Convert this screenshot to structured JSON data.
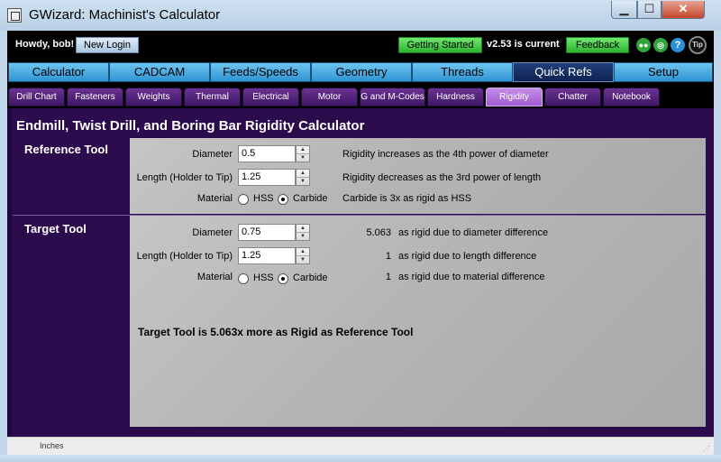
{
  "window": {
    "title": "GWizard: Machinist's Calculator",
    "icon": "app-icon"
  },
  "header": {
    "greeting": "Howdy, bob!",
    "new_login": "New Login",
    "getting_started": "Getting Started",
    "version": "v2.53 is current",
    "feedback": "Feedback",
    "tip": "Tip"
  },
  "main_tabs": [
    "Calculator",
    "CADCAM",
    "Feeds/Speeds",
    "Geometry",
    "Threads",
    "Quick Refs",
    "Setup"
  ],
  "active_main_tab": "Quick Refs",
  "sub_tabs": [
    "Drill Chart",
    "Fasteners",
    "Weights",
    "Thermal",
    "Electrical",
    "Motor",
    "G and M-Codes",
    "Hardness",
    "Rigidity",
    "Chatter",
    "Notebook"
  ],
  "active_sub_tab": "Rigidity",
  "calculator": {
    "title": "Endmill, Twist Drill, and Boring Bar Rigidity Calculator",
    "reference": {
      "heading": "Reference Tool",
      "diameter_label": "Diameter",
      "diameter": "0.5",
      "length_label": "Length (Holder to Tip)",
      "length": "1.25",
      "material_label": "Material",
      "hss_label": "HSS",
      "carbide_label": "Carbide",
      "selected_material": "Carbide",
      "note_diameter": "Rigidity increases as the 4th power of diameter",
      "note_length": "Rigidity decreases as the 3rd power of length",
      "note_material": "Carbide is 3x as rigid as HSS"
    },
    "target": {
      "heading": "Target Tool",
      "diameter_label": "Diameter",
      "diameter": "0.75",
      "length_label": "Length (Holder to Tip)",
      "length": "1.25",
      "material_label": "Material",
      "hss_label": "HSS",
      "carbide_label": "Carbide",
      "selected_material": "Carbide",
      "diameter_factor": "5.063",
      "diameter_factor_text": "as rigid due to diameter difference",
      "length_factor": "1",
      "length_factor_text": "as rigid due to length difference",
      "material_factor": "1",
      "material_factor_text": "as rigid due to material difference"
    },
    "result": "Target Tool is 5.063x more as Rigid as Reference Tool"
  },
  "status": {
    "units": "Inches"
  }
}
